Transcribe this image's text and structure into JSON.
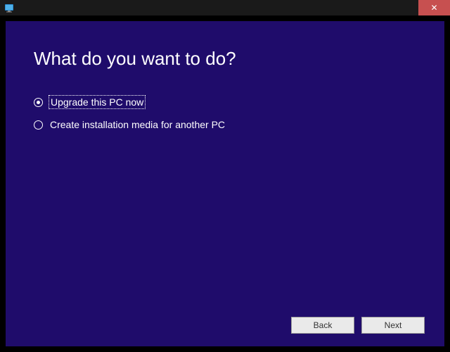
{
  "window": {
    "close_glyph": "✕"
  },
  "page": {
    "heading": "What do you want to do?",
    "options": [
      {
        "label": "Upgrade this PC now",
        "selected": true
      },
      {
        "label": "Create installation media for another PC",
        "selected": false
      }
    ]
  },
  "footer": {
    "back_label": "Back",
    "next_label": "Next"
  },
  "colors": {
    "background": "#1f0c6b",
    "close_button": "#c75050"
  }
}
